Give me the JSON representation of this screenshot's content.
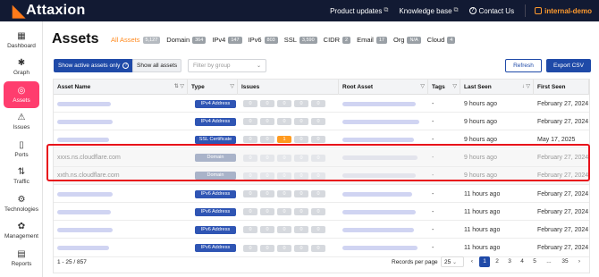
{
  "app": {
    "logo_text": "Attaxion"
  },
  "topbar": {
    "product_updates": "Product updates",
    "knowledge_base": "Knowledge base",
    "contact_us": "Contact Us",
    "user": "internal-demo"
  },
  "sidebar": {
    "items": [
      {
        "label": "Dashboard",
        "icon": "grid-icon"
      },
      {
        "label": "Graph",
        "icon": "graph-icon"
      },
      {
        "label": "Assets",
        "icon": "assets-icon",
        "active": true
      },
      {
        "label": "Issues",
        "icon": "warning-icon"
      },
      {
        "label": "Ports",
        "icon": "port-icon"
      },
      {
        "label": "Traffic",
        "icon": "traffic-icon"
      },
      {
        "label": "Technologies",
        "icon": "tech-icon"
      },
      {
        "label": "Management",
        "icon": "gear-icon"
      },
      {
        "label": "Reports",
        "icon": "report-icon"
      }
    ]
  },
  "page": {
    "title": "Assets"
  },
  "tabs": [
    {
      "label": "All Assets",
      "count": "5,127"
    },
    {
      "label": "Domain",
      "count": "364"
    },
    {
      "label": "IPv4",
      "count": "147"
    },
    {
      "label": "IPv6",
      "count": "803"
    },
    {
      "label": "SSL",
      "count": "3,590"
    },
    {
      "label": "CIDR",
      "count": "2"
    },
    {
      "label": "Email",
      "count": "17"
    },
    {
      "label": "Org",
      "count": "N/A"
    },
    {
      "label": "Cloud",
      "count": "4"
    }
  ],
  "controls": {
    "show_active": "Show active assets only",
    "show_all": "Show all assets",
    "group_placeholder": "Filter by group",
    "refresh": "Refresh",
    "export": "Export CSV"
  },
  "table": {
    "headers": [
      "Asset Name",
      "Type",
      "Issues",
      "Root Asset",
      "Tags",
      "Last Seen",
      "First Seen"
    ],
    "rows": [
      {
        "type": "IPv4 Address",
        "issues": [
          "0",
          "0",
          "0",
          "0",
          "0"
        ],
        "tags": "-",
        "last_seen": "9 hours ago",
        "first_seen": "February 27, 2024"
      },
      {
        "type": "IPv4 Address",
        "issues": [
          "0",
          "0",
          "0",
          "0",
          "0"
        ],
        "tags": "-",
        "last_seen": "9 hours ago",
        "first_seen": "February 27, 2024"
      },
      {
        "type": "SSL Certificate",
        "issues": [
          "0",
          "0",
          "1",
          "0",
          "0"
        ],
        "tags": "-",
        "last_seen": "9 hours ago",
        "first_seen": "May 17, 2025"
      },
      {
        "name": "xxxs.ns.cloudflare.com",
        "type": "Domain",
        "issues": [
          "0",
          "0",
          "0",
          "0",
          "0"
        ],
        "tags": "-",
        "last_seen": "9 hours ago",
        "first_seen": "February 27, 2024",
        "dim": true
      },
      {
        "name": "xxth.ns.cloudflare.com",
        "type": "Domain",
        "issues": [
          "0",
          "0",
          "0",
          "0",
          "0"
        ],
        "tags": "-",
        "last_seen": "9 hours ago",
        "first_seen": "February 27, 2024",
        "dim": true
      },
      {
        "type": "IPv6 Address",
        "issues": [
          "0",
          "0",
          "0",
          "0",
          "0"
        ],
        "tags": "-",
        "last_seen": "11 hours ago",
        "first_seen": "February 27, 2024"
      },
      {
        "type": "IPv6 Address",
        "issues": [
          "0",
          "0",
          "0",
          "0",
          "0"
        ],
        "tags": "-",
        "last_seen": "11 hours ago",
        "first_seen": "February 27, 2024"
      },
      {
        "type": "IPv6 Address",
        "issues": [
          "0",
          "0",
          "0",
          "0",
          "0"
        ],
        "tags": "-",
        "last_seen": "11 hours ago",
        "first_seen": "February 27, 2024"
      },
      {
        "type": "IPv6 Address",
        "issues": [
          "0",
          "0",
          "0",
          "0",
          "0"
        ],
        "tags": "-",
        "last_seen": "11 hours ago",
        "first_seen": "February 27, 2024"
      }
    ]
  },
  "footer": {
    "range": "1 - 25 / 857",
    "records_per_page_label": "Records per page",
    "records_per_page": "25",
    "pages": [
      "1",
      "2",
      "3",
      "4",
      "5",
      "...",
      "35"
    ]
  },
  "colors": {
    "accent": "#ff3d6e",
    "primary": "#1f4aa8",
    "topbar": "#121a33",
    "highlight": "#e8101a"
  }
}
